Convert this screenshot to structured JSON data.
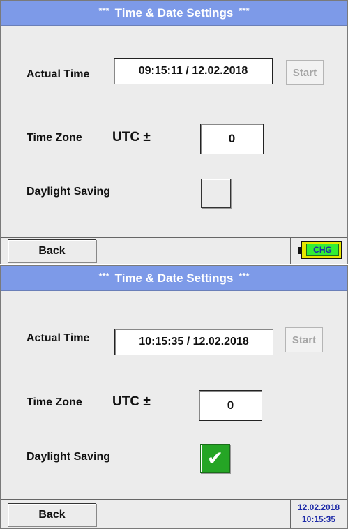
{
  "screens": [
    {
      "title": "Time & Date Settings",
      "title_stars": "***",
      "actual_time_label": "Actual Time",
      "actual_time_value": "09:15:11 / 12.02.2018",
      "start_label": "Start",
      "time_zone_label": "Time Zone",
      "utc_label": "UTC ±",
      "time_zone_value": "0",
      "daylight_label": "Daylight Saving",
      "daylight_checked": false,
      "back_label": "Back",
      "battery_status": "CHG"
    },
    {
      "title": "Time & Date Settings",
      "title_stars": "***",
      "actual_time_label": "Actual Time",
      "actual_time_value": "10:15:35 / 12.02.2018",
      "start_label": "Start",
      "time_zone_label": "Time Zone",
      "utc_label": "UTC ±",
      "time_zone_value": "0",
      "daylight_label": "Daylight Saving",
      "daylight_checked": true,
      "checkmark_glyph": "✔",
      "back_label": "Back",
      "status_date": "12.02.2018",
      "status_time": "10:15:35"
    }
  ],
  "colors": {
    "title_bar": "#7d9ae8",
    "panel_bg": "#ececec",
    "checked_green": "#25a525",
    "battery_yellow": "#e6e600",
    "status_text_blue": "#1d2aa8"
  },
  "icons": {
    "battery": "battery-charging-icon",
    "checkmark": "checkmark-icon"
  }
}
